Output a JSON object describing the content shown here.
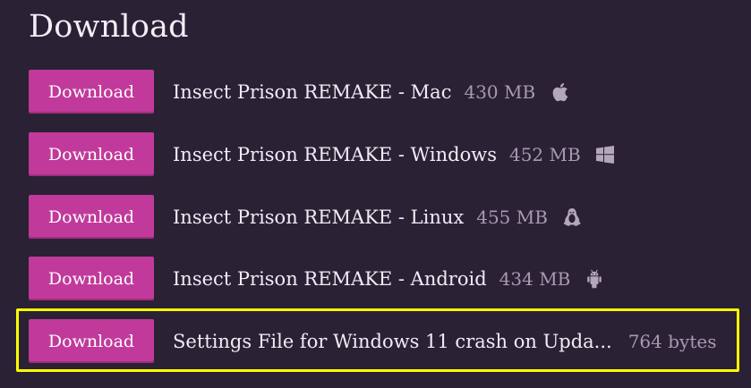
{
  "page": {
    "title": "Download"
  },
  "downloads": [
    {
      "button_label": "Download",
      "name": "Insect Prison REMAKE - Mac",
      "size": "430 MB",
      "platform_icon": "apple-icon"
    },
    {
      "button_label": "Download",
      "name": "Insect Prison REMAKE - Windows",
      "size": "452 MB",
      "platform_icon": "windows-icon"
    },
    {
      "button_label": "Download",
      "name": "Insect Prison REMAKE - Linux",
      "size": "455 MB",
      "platform_icon": "linux-icon"
    },
    {
      "button_label": "Download",
      "name": "Insect Prison REMAKE - Android",
      "size": "434 MB",
      "platform_icon": "android-icon"
    },
    {
      "button_label": "Download",
      "name": "Settings File for Windows 11 crash on Upda...",
      "size": "764 bytes",
      "platform_icon": ""
    }
  ],
  "colors": {
    "background": "#2a2135",
    "button": "#c13a9b",
    "muted_text": "#a79bb0",
    "highlight": "#fefe00"
  }
}
